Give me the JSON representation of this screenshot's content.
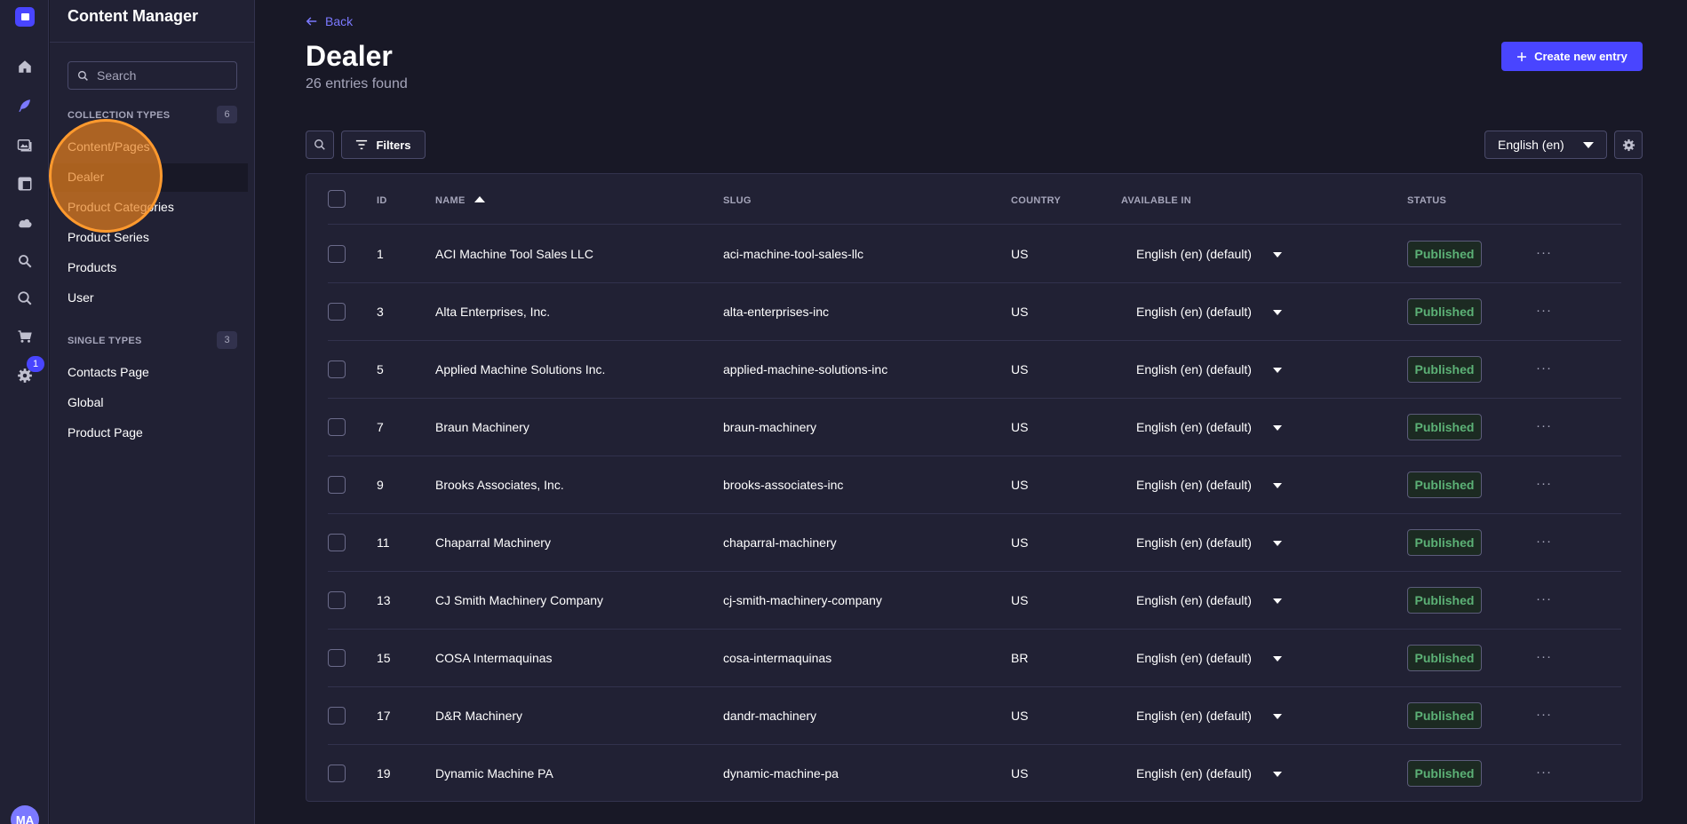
{
  "app": {
    "title": "Content Manager",
    "notification_count": "1",
    "user_initials": "MA"
  },
  "sidebar": {
    "search_placeholder": "Search",
    "collection_label": "COLLECTION TYPES",
    "collection_count": "6",
    "collection_items": [
      "Content/Pages",
      "Dealer",
      "Product Categories",
      "Product Series",
      "Products",
      "User"
    ],
    "single_label": "SINGLE TYPES",
    "single_count": "3",
    "single_items": [
      "Contacts Page",
      "Global",
      "Product Page"
    ]
  },
  "header": {
    "back_label": "Back",
    "title": "Dealer",
    "subtitle": "26 entries found",
    "create_label": "Create new entry"
  },
  "toolbar": {
    "filters_label": "Filters",
    "locale": "English (en)"
  },
  "table": {
    "columns": {
      "id": "ID",
      "name": "NAME",
      "slug": "SLUG",
      "country": "COUNTRY",
      "available": "AVAILABLE IN",
      "status": "STATUS"
    },
    "rows": [
      {
        "id": "1",
        "name": "ACI Machine Tool Sales LLC",
        "slug": "aci-machine-tool-sales-llc",
        "country": "US",
        "available": "English (en) (default)",
        "status": "Published"
      },
      {
        "id": "3",
        "name": "Alta Enterprises, Inc.",
        "slug": "alta-enterprises-inc",
        "country": "US",
        "available": "English (en) (default)",
        "status": "Published"
      },
      {
        "id": "5",
        "name": "Applied Machine Solutions Inc.",
        "slug": "applied-machine-solutions-inc",
        "country": "US",
        "available": "English (en) (default)",
        "status": "Published"
      },
      {
        "id": "7",
        "name": "Braun Machinery",
        "slug": "braun-machinery",
        "country": "US",
        "available": "English (en) (default)",
        "status": "Published"
      },
      {
        "id": "9",
        "name": "Brooks Associates, Inc.",
        "slug": "brooks-associates-inc",
        "country": "US",
        "available": "English (en) (default)",
        "status": "Published"
      },
      {
        "id": "11",
        "name": "Chaparral Machinery",
        "slug": "chaparral-machinery",
        "country": "US",
        "available": "English (en) (default)",
        "status": "Published"
      },
      {
        "id": "13",
        "name": "CJ Smith Machinery Company",
        "slug": "cj-smith-machinery-company",
        "country": "US",
        "available": "English (en) (default)",
        "status": "Published"
      },
      {
        "id": "15",
        "name": "COSA Intermaquinas",
        "slug": "cosa-intermaquinas",
        "country": "BR",
        "available": "English (en) (default)",
        "status": "Published"
      },
      {
        "id": "17",
        "name": "D&R Machinery",
        "slug": "dandr-machinery",
        "country": "US",
        "available": "English (en) (default)",
        "status": "Published"
      },
      {
        "id": "19",
        "name": "Dynamic Machine PA",
        "slug": "dynamic-machine-pa",
        "country": "US",
        "available": "English (en) (default)",
        "status": "Published"
      }
    ]
  },
  "colors": {
    "accent": "#4945ff",
    "published": "#5cb176",
    "click_marker": "#ff9a2e"
  }
}
